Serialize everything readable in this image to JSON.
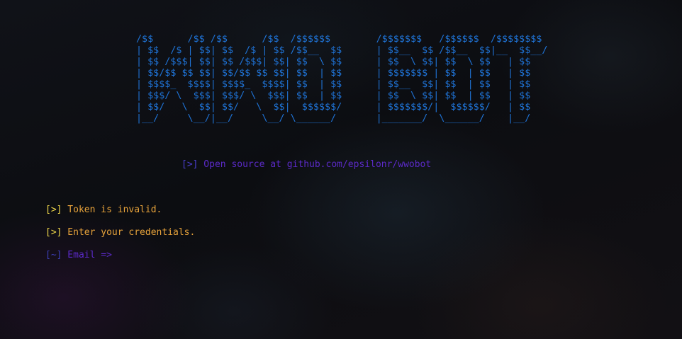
{
  "banner": {
    "art": "/$$      /$$ /$$      /$$  /$$$$$$        /$$$$$$$   /$$$$$$  /$$$$$$$$\n| $$  /$ | $$| $$  /$ | $$ /$$__  $$      | $$__  $$ /$$__  $$|__  $$__/\n| $$ /$$$| $$| $$ /$$$| $$| $$  \\ $$      | $$  \\ $$| $$  \\ $$   | $$\n| $$/$$ $$ $$| $$/$$ $$ $$| $$  | $$      | $$$$$$$ | $$  | $$   | $$\n| $$$$_  $$$$| $$$$_  $$$$| $$  | $$      | $$__  $$| $$  | $$   | $$\n| $$$/ \\  $$$| $$$/ \\  $$$| $$  | $$      | $$  \\ $$| $$  | $$   | $$\n| $$/   \\  $$| $$/   \\  $$|  $$$$$$/      | $$$$$$$/|  $$$$$$/   | $$\n|__/     \\__/|__/     \\__/ \\______/       |_______/  \\______/    |__/"
  },
  "source_line": {
    "prefix": "[>]",
    "text": " Open source at github.com/epsilonr/wwobot"
  },
  "messages": [
    {
      "prefix": "[>]",
      "text": " Token is invalid."
    },
    {
      "prefix": "[>]",
      "text": " Enter your credentials."
    }
  ],
  "prompt": {
    "prefix": "[~]",
    "text": " Email =>"
  },
  "colors": {
    "background": "#0e0f13",
    "banner": "#1f73d6",
    "message": "#e8a33b",
    "message_prefix": "#f0d84a",
    "prompt": "#5b2ac8"
  }
}
